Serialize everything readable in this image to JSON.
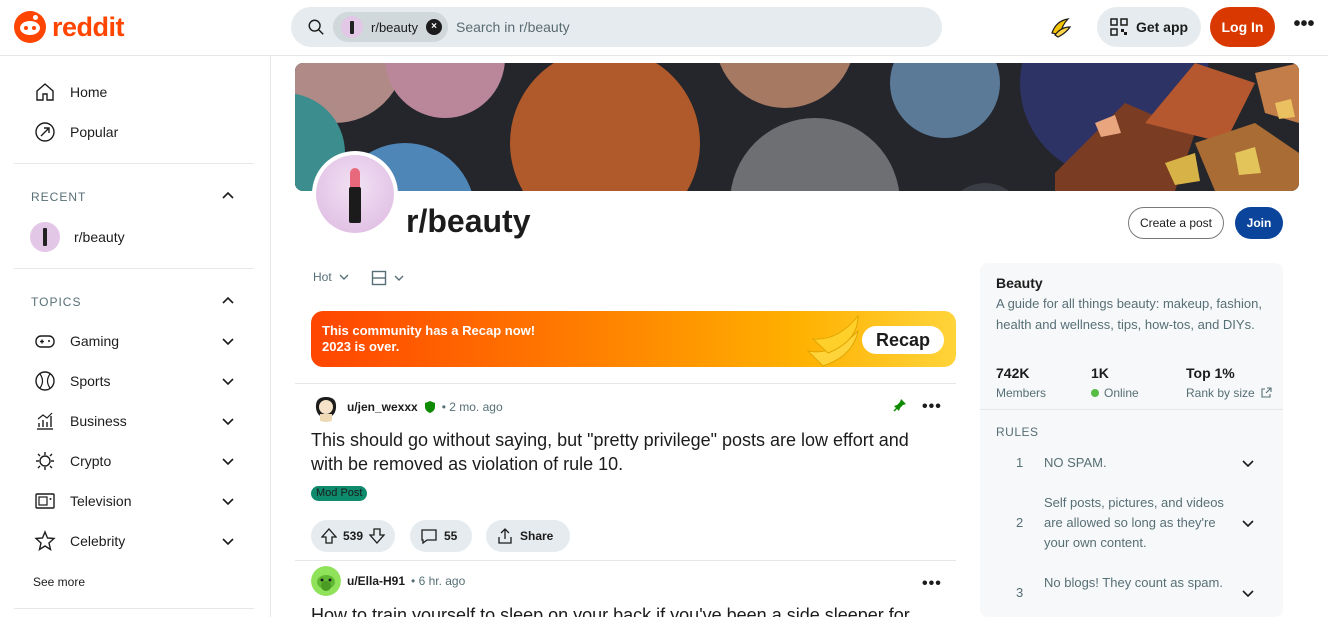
{
  "header": {
    "logo_text": "reddit",
    "search_chip": "r/beauty",
    "search_chip_close": "×",
    "search_placeholder": "Search in r/beauty",
    "getapp_label": "Get app",
    "login_label": "Log In",
    "more": "•••"
  },
  "sidebar": {
    "nav": [
      {
        "label": "Home",
        "icon": "home-icon"
      },
      {
        "label": "Popular",
        "icon": "popular-icon"
      }
    ],
    "recent_title": "RECENT",
    "recent_items": [
      {
        "label": "r/beauty"
      }
    ],
    "topics_title": "TOPICS",
    "topics": [
      {
        "label": "Gaming",
        "icon": "gamepad-icon"
      },
      {
        "label": "Sports",
        "icon": "ball-icon"
      },
      {
        "label": "Business",
        "icon": "chart-icon"
      },
      {
        "label": "Crypto",
        "icon": "crypto-icon"
      },
      {
        "label": "Television",
        "icon": "tv-icon"
      },
      {
        "label": "Celebrity",
        "icon": "star-icon"
      }
    ],
    "see_more": "See more"
  },
  "subreddit": {
    "name": "r/beauty",
    "create_post": "Create a post",
    "join": "Join"
  },
  "feed": {
    "sort_label": "Hot",
    "recap_line1": "This community has a Recap now!",
    "recap_line2": "2023 is over.",
    "recap_button": "Recap",
    "posts": [
      {
        "author": "u/jen_wexxx",
        "time": "• 2 mo. ago",
        "title": "This should go without saying, but \"pretty privilege\" posts are low effort and with be removed as violation of rule 10.",
        "flair": "Mod Post",
        "votes": "539",
        "comments": "55",
        "share": "Share",
        "more": "•••"
      },
      {
        "author": "u/Ella-H91",
        "time": "• 6 hr. ago",
        "title": "How to train yourself to sleep on your back if you've been a side sleeper for",
        "more": "•••"
      }
    ]
  },
  "panel": {
    "name": "Beauty",
    "description": "A guide for all things beauty: makeup, fashion, health and wellness, tips, how-tos, and DIYs.",
    "stats": [
      {
        "value": "742K",
        "label": "Members"
      },
      {
        "value": "1K",
        "label": "Online"
      },
      {
        "value": "Top 1%",
        "label": "Rank by size"
      }
    ],
    "rules_title": "RULES",
    "rules": [
      {
        "num": "1",
        "text": "NO SPAM."
      },
      {
        "num": "2",
        "text": "Self posts, pictures, and videos are allowed so long as they're your own content."
      },
      {
        "num": "3",
        "text": "No blogs! They count as spam."
      }
    ]
  },
  "colors": {
    "brand": "#ff4500",
    "login": "#d93900",
    "join": "#0a449b",
    "flair": "#0e8a6d",
    "online": "#55bd46"
  }
}
